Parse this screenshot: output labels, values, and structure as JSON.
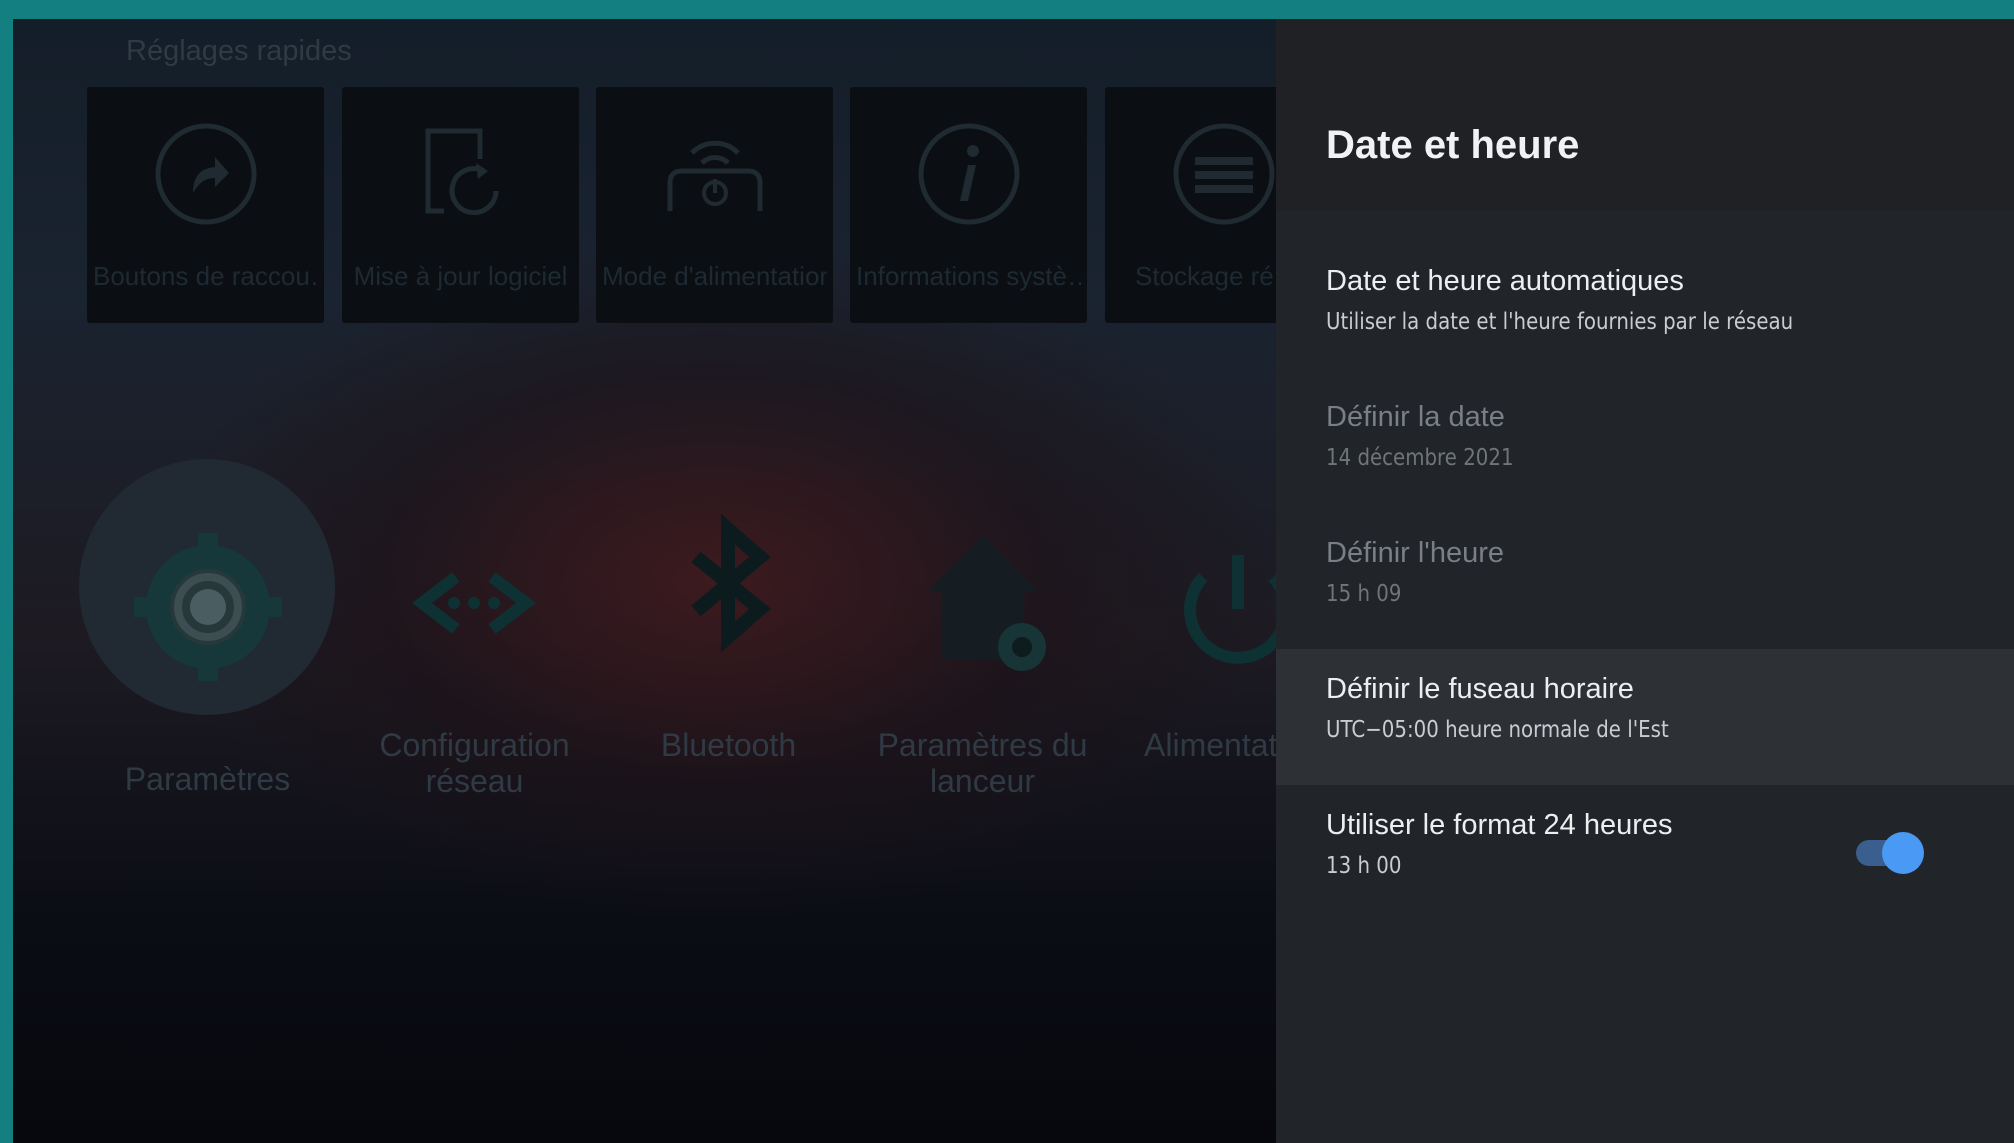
{
  "background": {
    "quick_settings": {
      "title": "Réglages rapides",
      "tiles": [
        {
          "label": "Boutons de raccou…",
          "icon": "shortcut-icon"
        },
        {
          "label": "Mise à jour logiciel",
          "icon": "software-update-icon"
        },
        {
          "label": "Mode d'alimentation",
          "icon": "power-mode-icon"
        },
        {
          "label": "Informations systè…",
          "icon": "info-icon"
        },
        {
          "label": "Stockage ré",
          "icon": "storage-icon"
        }
      ]
    },
    "apps": [
      {
        "label": "Paramètres",
        "icon": "settings-gear-icon"
      },
      {
        "label": "Configuration réseau",
        "icon": "network-config-icon"
      },
      {
        "label": "Bluetooth",
        "icon": "bluetooth-icon"
      },
      {
        "label": "Paramètres du lanceur",
        "icon": "launcher-settings-icon"
      },
      {
        "label": "Alimentati",
        "icon": "power-icon"
      }
    ]
  },
  "panel": {
    "title": "Date et heure",
    "items": [
      {
        "title": "Date et heure automatiques",
        "subtitle": "Utiliser la date et l'heure fournies par le réseau",
        "enabled": true,
        "focused": false
      },
      {
        "title": "Définir la date",
        "subtitle": "14 décembre 2021",
        "enabled": false,
        "focused": false
      },
      {
        "title": "Définir l'heure",
        "subtitle": "15 h 09",
        "enabled": false,
        "focused": false
      },
      {
        "title": "Définir le fuseau horaire",
        "subtitle": "UTC−05:00 heure normale de l'Est",
        "enabled": true,
        "focused": true
      },
      {
        "title": "Utiliser le format 24 heures",
        "subtitle": "13 h 00",
        "enabled": true,
        "focused": false,
        "toggle_on": true
      }
    ]
  },
  "colors": {
    "frame": "#137f80",
    "panel": "#212428",
    "focus": "#2d3035",
    "toggle_thumb": "#4a9af5",
    "toggle_track": "#3a5f8e",
    "dim_icon": "#0f3434"
  }
}
